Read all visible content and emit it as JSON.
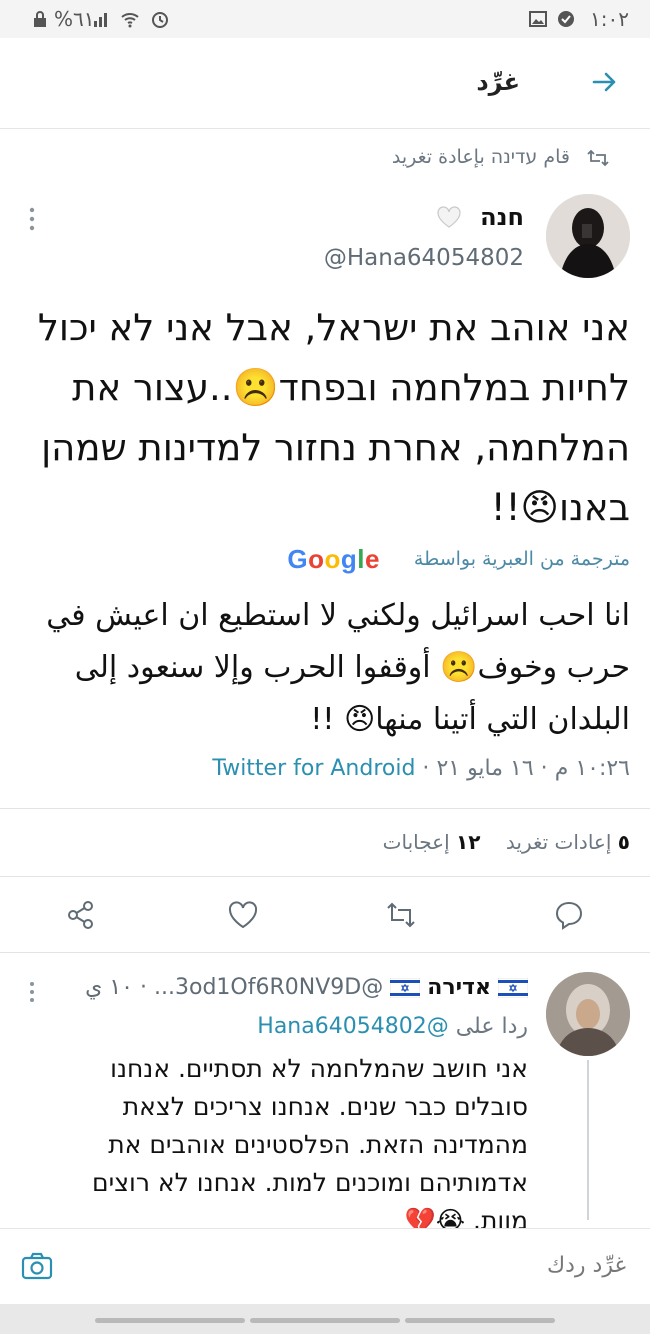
{
  "status_bar": {
    "left_text": "%٦١",
    "time": "١:٠٢"
  },
  "header": {
    "title": "غرِّد"
  },
  "retweet_line": {
    "text": "قام עדינה بإعادة تغريد"
  },
  "tweet": {
    "author_name": "חנה",
    "handle": "@Hana64054802",
    "text": "אני אוהב את ישראל, אבל אני לא יכול לחיות במלחמה ובפחד☹️..עצור את המלחמה, אחרת נחזור למדינות שמהן באנו😠!!",
    "translated_label": "مترجمة من العبرية بواسطة",
    "translated_text": "انا احب اسرائيل ولكني لا استطيع ان اعيش في حرب وخوف☹️ أوقفوا الحرب وإلا سنعود إلى البلدان التي أتينا منها😠 !!",
    "time": "١٠:٢٦ م",
    "date": "١٦ مايو ٢١",
    "app": "Twitter for Android",
    "retweets_count": "٥",
    "retweets_label": "إعادات تغريد",
    "likes_count": "١٢",
    "likes_label": "إعجابات"
  },
  "reply": {
    "author_name": "אדירה",
    "handle": "@3od1Of6R0NV9D...",
    "time": "١٠ ي",
    "replying_to_label": "ردا على",
    "replying_to_handle": "@Hana64054802",
    "text": "אני חושב שהמלחמה לא תסתיים. אנחנו סובלים כבר שנים. אנחנו צריכים לצאת מהמדינה הזאת. הפלסטינים אוהבים את אדמותיהם ומוכנים למות. אנחנו לא רוצים מוות. 😭💔"
  },
  "compose": {
    "placeholder": "غرِّد ردك"
  },
  "colors": {
    "accent": "#2a8fb0",
    "secondary_text": "#6b7680"
  }
}
